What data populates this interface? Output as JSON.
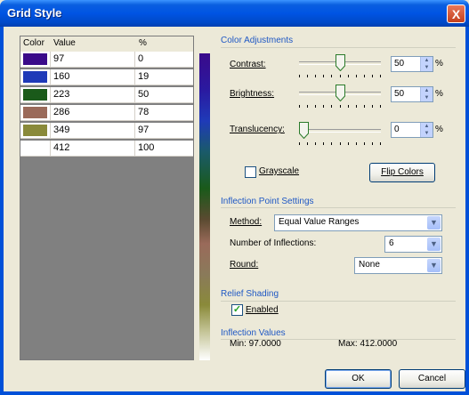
{
  "window": {
    "title": "Grid Style",
    "close_glyph": "X"
  },
  "table": {
    "headers": {
      "color": "Color",
      "value": "Value",
      "percent": "%"
    },
    "rows": [
      {
        "color": "#3a0a8a",
        "value": "97",
        "percent": "0"
      },
      {
        "color": "#1f3ab8",
        "value": "160",
        "percent": "19"
      },
      {
        "color": "#1a5a1a",
        "value": "223",
        "percent": "50"
      },
      {
        "color": "#9a6a5a",
        "value": "286",
        "percent": "78"
      },
      {
        "color": "#8a8a3a",
        "value": "349",
        "percent": "97"
      },
      {
        "color": "#ffffff",
        "value": "412",
        "percent": "100"
      }
    ]
  },
  "color_adjustments": {
    "title": "Color Adjustments",
    "contrast": {
      "label": "Contrast:",
      "value": "50",
      "unit": "%",
      "level": 0.5
    },
    "brightness": {
      "label": "Brightness:",
      "value": "50",
      "unit": "%",
      "level": 0.5
    },
    "translucency": {
      "label": "Translucency:",
      "value": "0",
      "unit": "%",
      "level": 0.0
    },
    "grayscale": {
      "label": "Grayscale",
      "checked": false
    },
    "flip_colors": "Flip Colors"
  },
  "inflection": {
    "title": "Inflection Point Settings",
    "method_label": "Method:",
    "method_value": "Equal Value Ranges",
    "count_label": "Number of Inflections:",
    "count_value": "6",
    "round_label": "Round:",
    "round_value": "None"
  },
  "relief": {
    "title": "Relief Shading",
    "enabled_label": "Enabled",
    "enabled": true
  },
  "inflection_values": {
    "title": "Inflection Values",
    "min": "Min: 97.0000",
    "max": "Max: 412.0000"
  },
  "buttons": {
    "ok": "OK",
    "cancel": "Cancel"
  },
  "colors": {
    "title_bar": "#0054e3",
    "section_heading": "#1f58c4",
    "dialog_bg": "#ece9d8"
  }
}
